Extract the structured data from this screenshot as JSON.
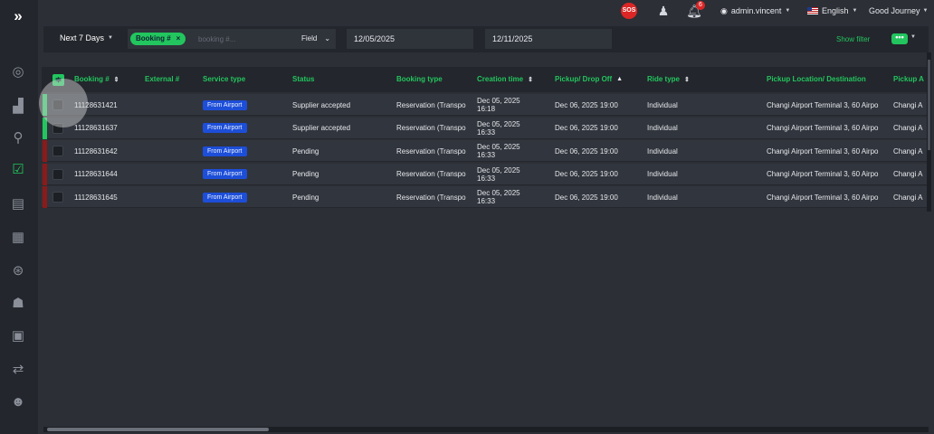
{
  "sidebar": {
    "toggle": "»",
    "icons": [
      "dashboard-icon",
      "analytics-icon",
      "location-icon",
      "bookings-icon",
      "documents-icon",
      "calendar-icon",
      "steering-wheel-icon",
      "users-icon",
      "contacts-icon",
      "routes-icon",
      "team-icon"
    ]
  },
  "topbar": {
    "sos": "SOS",
    "notifications_count": "6",
    "username": "admin.vincent",
    "language": "English",
    "company": "Good Journey"
  },
  "filters": {
    "range": "Next 7 Days",
    "chip": "Booking #",
    "chip_close": "×",
    "search_placeholder": "booking #...",
    "field": "Field",
    "field_caret": "⌄",
    "date_from": "12/05/2025",
    "date_to": "12/11/2025",
    "show_filter": "Show filter",
    "more": "•••"
  },
  "table": {
    "columns": [
      "Booking #",
      "External #",
      "Service type",
      "Status",
      "Booking type",
      "Creation time",
      "Pickup/ Drop Off",
      "Ride type",
      "Pickup Location/ Destination",
      "Pickup A"
    ],
    "rows": [
      {
        "booking": "11128631421",
        "external": "",
        "service": "From Airport",
        "status": "Supplier accepted",
        "btype": "Reservation (Transpo",
        "created": "Dec 05, 2025 16:18",
        "pickup": "Dec 06, 2025 19:00",
        "ride": "Individual",
        "location": "Changi Airport Terminal 3, 60 Airpo",
        "pickup_a": "Changi A",
        "bar": "#22c55e"
      },
      {
        "booking": "11128631637",
        "external": "",
        "service": "From Airport",
        "status": "Supplier accepted",
        "btype": "Reservation (Transpo",
        "created": "Dec 05, 2025 16:33",
        "pickup": "Dec 06, 2025 19:00",
        "ride": "Individual",
        "location": "Changi Airport Terminal 3, 60 Airpo",
        "pickup_a": "Changi A",
        "bar": "#22c55e"
      },
      {
        "booking": "11128631642",
        "external": "",
        "service": "From Airport",
        "status": "Pending",
        "btype": "Reservation (Transpo",
        "created": "Dec 05, 2025 16:33",
        "pickup": "Dec 06, 2025 19:00",
        "ride": "Individual",
        "location": "Changi Airport Terminal 3, 60 Airpo",
        "pickup_a": "Changi A",
        "bar": "#8b1a1a"
      },
      {
        "booking": "11128631644",
        "external": "",
        "service": "From Airport",
        "status": "Pending",
        "btype": "Reservation (Transpo",
        "created": "Dec 05, 2025 16:33",
        "pickup": "Dec 06, 2025 19:00",
        "ride": "Individual",
        "location": "Changi Airport Terminal 3, 60 Airpo",
        "pickup_a": "Changi A",
        "bar": "#8b1a1a"
      },
      {
        "booking": "11128631645",
        "external": "",
        "service": "From Airport",
        "status": "Pending",
        "btype": "Reservation (Transpo",
        "created": "Dec 05, 2025 16:33",
        "pickup": "Dec 06, 2025 19:00",
        "ride": "Individual",
        "location": "Changi Airport Terminal 3, 60 Airpo",
        "pickup_a": "Changi A",
        "bar": "#8b1a1a"
      }
    ]
  }
}
